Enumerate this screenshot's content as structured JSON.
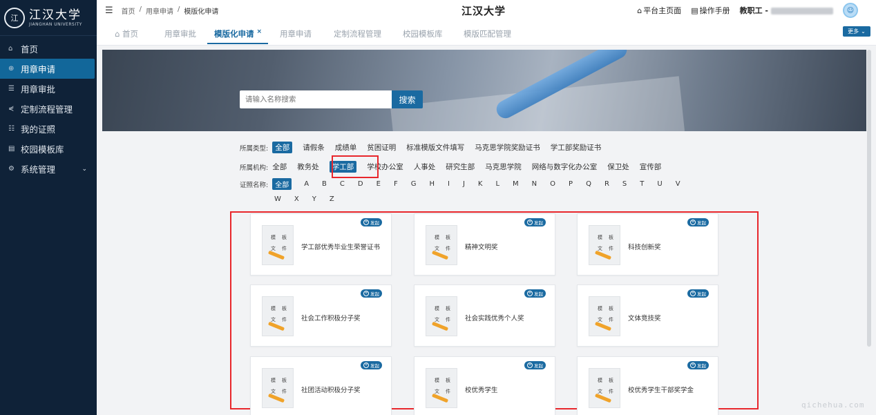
{
  "sidebar": {
    "logo": {
      "cn": "江汉大学",
      "en": "JIANGHAN UNIVERSITY",
      "seal": "江"
    },
    "items": [
      {
        "icon": "home-icon",
        "glyph": "⌂",
        "label": "首页"
      },
      {
        "icon": "target-icon",
        "glyph": "⊕",
        "label": "用章申请",
        "active": true
      },
      {
        "icon": "edit-icon",
        "glyph": "☰",
        "label": "用章审批"
      },
      {
        "icon": "share-icon",
        "glyph": "⋞",
        "label": "定制流程管理"
      },
      {
        "icon": "document-icon",
        "glyph": "☷",
        "label": "我的证照"
      },
      {
        "icon": "file-icon",
        "glyph": "▤",
        "label": "校园模板库"
      },
      {
        "icon": "gear-icon",
        "glyph": "⚙",
        "label": "系统管理",
        "chevron": "⌄"
      }
    ]
  },
  "header": {
    "hamburger": "☰",
    "breadcrumb": [
      "首页",
      "/",
      "用章申请",
      "/",
      "模版化申请"
    ],
    "title": "江汉大学",
    "home_link": "平台主页面",
    "manual_link": "操作手册",
    "user_label": "教职工 -",
    "home_glyph": "⌂",
    "manual_glyph": "▤",
    "avatar_glyph": "☺"
  },
  "tabs": {
    "items": [
      {
        "label": "首页",
        "icon": "⌂"
      },
      {
        "label": "用章审批"
      },
      {
        "label": "模版化申请",
        "active": true,
        "close": "×"
      },
      {
        "label": "用章申请"
      },
      {
        "label": "定制流程管理"
      },
      {
        "label": "校园模板库"
      },
      {
        "label": "模版匹配管理"
      }
    ],
    "more": "更多",
    "more_chev": "⌄"
  },
  "search": {
    "placeholder": "请输入名称搜索",
    "button": "搜索"
  },
  "filters": {
    "type": {
      "label": "所属类型:",
      "options": [
        "全部",
        "请假条",
        "成绩单",
        "贫困证明",
        "标准模版文件填写",
        "马克思学院奖励证书",
        "学工部奖励证书"
      ],
      "selected": 0
    },
    "org": {
      "label": "所属机构:",
      "options": [
        "全部",
        "教务处",
        "学工部",
        "学校办公室",
        "人事处",
        "研究生部",
        "马克思学院",
        "网络与数字化办公室",
        "保卫处",
        "宣传部"
      ],
      "selected": 2
    },
    "cert": {
      "label": "证照名称:",
      "options": [
        "全部",
        "A",
        "B",
        "C",
        "D",
        "E",
        "F",
        "G",
        "H",
        "I",
        "J",
        "K",
        "L",
        "M",
        "N",
        "O",
        "P",
        "Q",
        "R",
        "S",
        "T",
        "U",
        "V",
        "W",
        "X",
        "Y",
        "Z"
      ],
      "selected": 0
    }
  },
  "cards": {
    "badge": "发起",
    "badge_glyph": "+",
    "thumb_chars": [
      "模",
      "板",
      "文",
      "件"
    ],
    "items": [
      "学工部优秀毕业生荣誉证书",
      "精神文明奖",
      "科技创新奖",
      "社会工作积极分子奖",
      "社会实践优秀个人奖",
      "文体竞技奖",
      "社团活动积极分子奖",
      "校优秀学生",
      "校优秀学生干部奖学金"
    ]
  },
  "watermark": "qichehua.com",
  "colors": {
    "primary": "#1a6aa1",
    "sidebar": "#0f2238",
    "highlight": "#e8262b"
  }
}
